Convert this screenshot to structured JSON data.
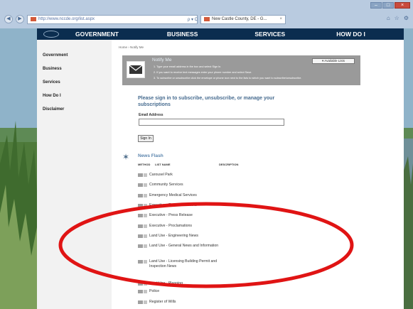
{
  "browser": {
    "address": "http://www.nccde.org/list.aspx",
    "tab_title": "New Castle County, DE - G...",
    "tab_close": "×",
    "addr_tools": "ρ ▾ C"
  },
  "topnav": [
    "GOVERNMENT",
    "BUSINESS",
    "SERVICES",
    "HOW DO I"
  ],
  "sidebar": [
    "Government",
    "Business",
    "Services",
    "How Do I",
    "Disclaimer"
  ],
  "breadcrumb": "Home › Notify Me",
  "notify": {
    "title": "Notify Me",
    "steps": [
      "1.   Type your email address in the box and select Sign In.",
      "2.   If you want to receive text messages enter your phone number and select Save.",
      "3.   To subscribe or unsubscribe click the envelope or phone icon next to the lists to which you want to subscribe/unsubscribe."
    ],
    "available_lists": "Available Lists"
  },
  "signin": {
    "heading": "Please sign in to subscribe, unsubscribe, or manage your subscriptions",
    "email_label": "Email Address",
    "email_value": "",
    "button": "Sign In"
  },
  "news": {
    "title": "News Flash",
    "columns": [
      "METHOD",
      "LIST NAME",
      "DESCRIPTION"
    ],
    "items": [
      "Carousel Park",
      "Community Services",
      "Emergency Medical Services",
      "Executive - Executive Orders",
      "Executive - Press Release",
      "Executive - Proclamations",
      "Land Use - Engineering News",
      "Land Use - General News and Information",
      "Land Use - Licensing Building Permit and Inspection News",
      "Land Use - Planning",
      "Police",
      "Register of Wills"
    ]
  },
  "colors": {
    "nav": "#0b2d4f",
    "annotation": "#e01414",
    "notify_bg": "#9a9a9a",
    "link": "#466b8f"
  }
}
